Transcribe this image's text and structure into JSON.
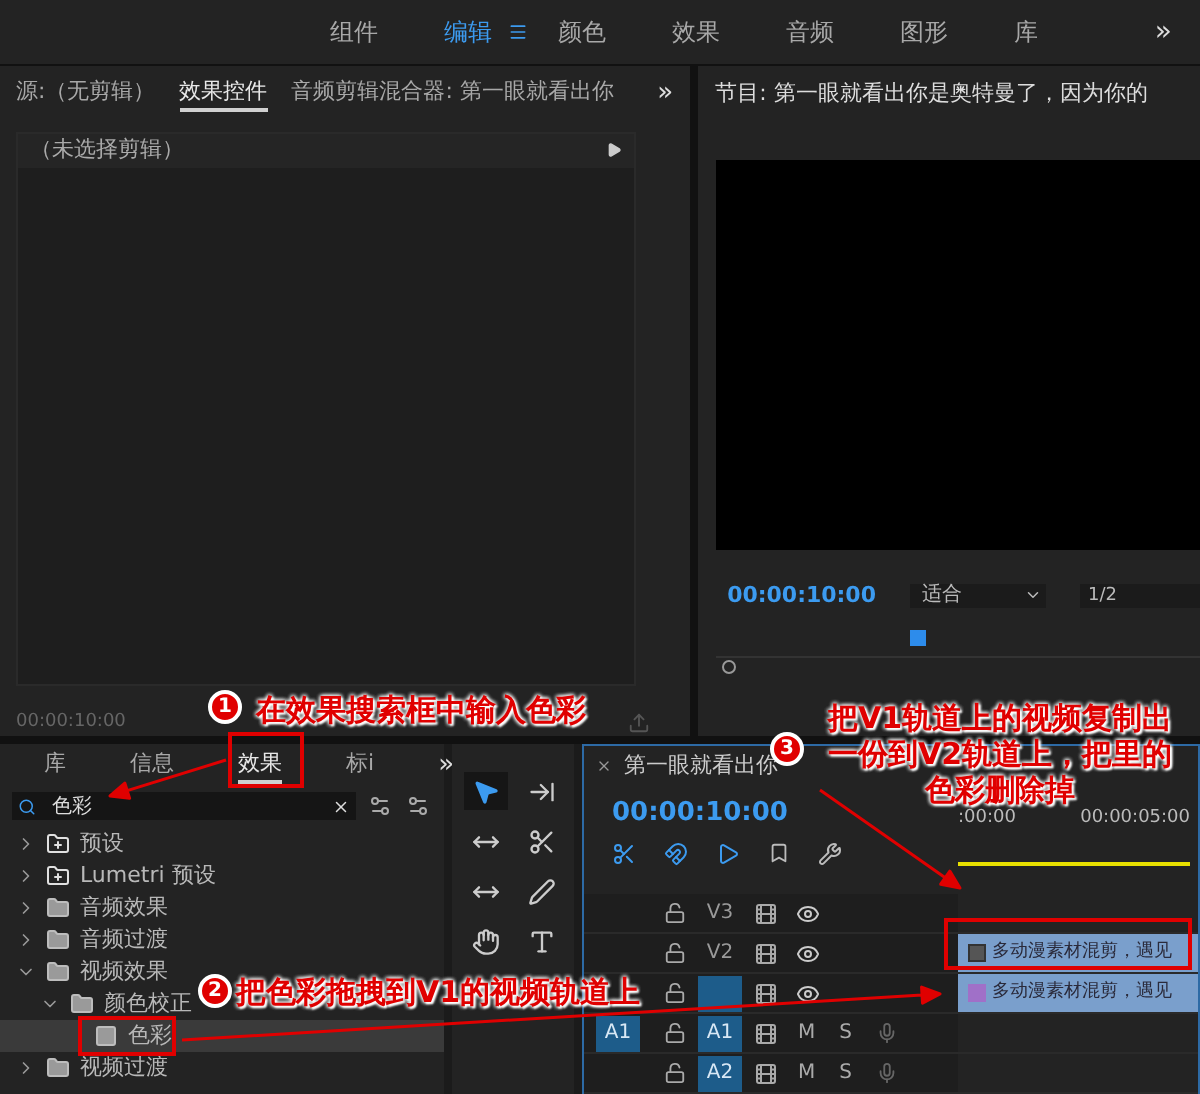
{
  "workspace_tabs": [
    {
      "label": "组件",
      "selected": false
    },
    {
      "label": "编辑",
      "selected": true
    },
    {
      "label": "颜色",
      "selected": false
    },
    {
      "label": "效果",
      "selected": false
    },
    {
      "label": "音频",
      "selected": false
    },
    {
      "label": "图形",
      "selected": false
    },
    {
      "label": "库",
      "selected": false
    }
  ],
  "workspace_more": "»",
  "source_panel": {
    "tabs": [
      {
        "label": "源:（无剪辑）",
        "selected": false
      },
      {
        "label": "效果控件",
        "selected": true
      },
      {
        "label": "音频剪辑混合器: 第一眼就看出你",
        "selected": false
      }
    ],
    "more": "»",
    "clip_header": "（未选择剪辑）",
    "timecode": "00:00:10:00"
  },
  "program_monitor": {
    "title": "节目: 第一眼就看出你是奥特曼了，因为你的",
    "timecode": "00:00:10:00",
    "zoom": "适合",
    "resolution": "1/2",
    "level": 0.4
  },
  "effects_panel": {
    "tabs": [
      {
        "label": "库",
        "selected": false
      },
      {
        "label": "信息",
        "selected": false
      },
      {
        "label": "效果",
        "selected": true
      },
      {
        "label": "标i",
        "selected": false
      }
    ],
    "more": "»",
    "search": {
      "value": "色彩"
    },
    "tree": [
      {
        "label": "预设",
        "kind": "preset",
        "expanded": false,
        "selected": false
      },
      {
        "label": "Lumetri 预设",
        "kind": "preset",
        "expanded": false,
        "selected": false
      },
      {
        "label": "音频效果",
        "kind": "folder",
        "expanded": false,
        "selected": false
      },
      {
        "label": "音频过渡",
        "kind": "folder",
        "expanded": false,
        "selected": false
      },
      {
        "label": "视频效果",
        "kind": "folder",
        "expanded": true,
        "selected": false,
        "children": [
          {
            "label": "颜色校正",
            "kind": "folder",
            "expanded": true,
            "selected": false,
            "children": [
              {
                "label": "色彩",
                "kind": "effect",
                "selected": true
              }
            ]
          }
        ]
      },
      {
        "label": "视频过渡",
        "kind": "folder",
        "expanded": false,
        "selected": false
      }
    ]
  },
  "tools": [
    {
      "kind": "selection",
      "selected": true
    },
    {
      "kind": "track-select",
      "selected": false
    },
    {
      "kind": "ripple",
      "selected": false
    },
    {
      "kind": "razor",
      "selected": false
    },
    {
      "kind": "slip",
      "selected": false
    },
    {
      "kind": "pen",
      "selected": false
    },
    {
      "kind": "hand",
      "selected": false
    },
    {
      "kind": "type",
      "selected": false
    }
  ],
  "timeline": {
    "title": "第一眼就看出你",
    "timecode": "00:00:10:00",
    "ruler": [
      ":00:00",
      "00:00:05:00"
    ],
    "tracks": [
      {
        "kind": "video",
        "name": "V3",
        "targeted": false
      },
      {
        "kind": "video",
        "name": "V2",
        "targeted": false,
        "clip": {
          "label": "多动漫素材混剪，遇见",
          "fx": false
        }
      },
      {
        "kind": "video",
        "targeted": true,
        "clip": {
          "label": "多动漫素材混剪，遇见",
          "fx": true
        }
      },
      {
        "kind": "audio",
        "source": "A1",
        "name": "A1",
        "targeted": true,
        "mute": "M",
        "solo": "S"
      },
      {
        "kind": "audio",
        "name": "A2",
        "targeted": true,
        "mute": "M",
        "solo": "S"
      }
    ]
  },
  "annotations": [
    {
      "number": "1",
      "lines": [
        "在效果搜索框中输入色彩"
      ]
    },
    {
      "number": "2",
      "lines": [
        "把色彩拖拽到V1的视频轨道上"
      ]
    },
    {
      "number": "3",
      "lines": [
        "把V1轨道上的视频复制出",
        "一份到V2轨道上，把里的",
        "色彩删除掉"
      ]
    }
  ]
}
